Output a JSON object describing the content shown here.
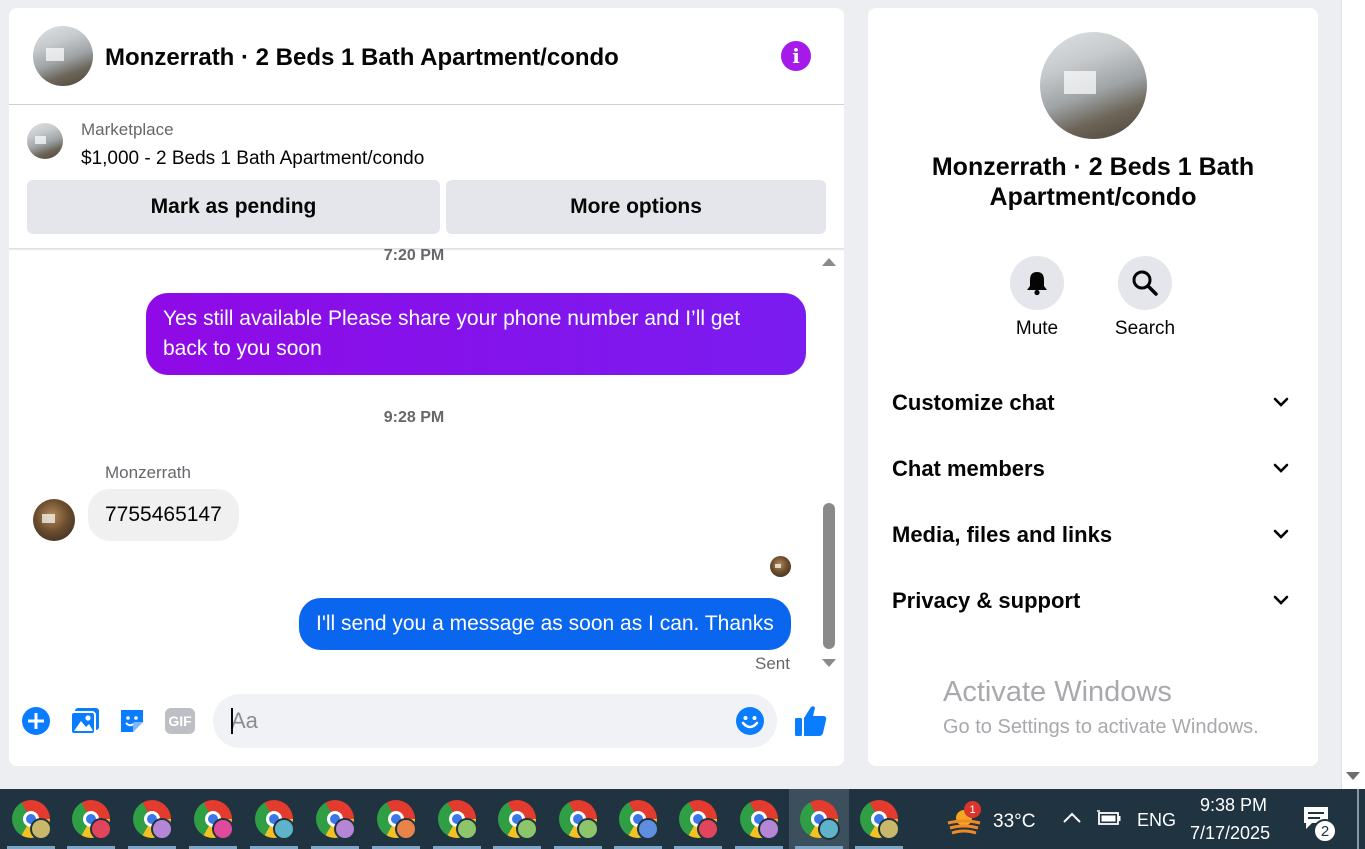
{
  "chat": {
    "title": "Monzerrath · 2 Beds 1 Bath Apartment/condo",
    "info_icon": "info-icon",
    "marketplace_label": "Marketplace",
    "listing": "$1,000 - 2 Beds 1 Bath Apartment/condo",
    "mark_pending_label": "Mark as pending",
    "more_options_label": "More options",
    "messages": [
      {
        "type": "timestamp",
        "text": "7:20 PM"
      },
      {
        "type": "outgoing",
        "text": "Yes still available Please share your phone number and I’ll get back to you soon"
      },
      {
        "type": "timestamp",
        "text": "9:28 PM"
      },
      {
        "type": "sender_name",
        "text": "Monzerrath"
      },
      {
        "type": "incoming",
        "text": "7755465147"
      },
      {
        "type": "outgoing",
        "text": "I'll send you a message as soon as I can. Thanks"
      },
      {
        "type": "status",
        "text": "Sent"
      }
    ],
    "composer": {
      "placeholder": "Aa",
      "icons": [
        "plus-icon",
        "photo-icon",
        "sticker-icon",
        "gif-icon",
        "emoji-icon",
        "like-icon"
      ],
      "gif_label": "GIF"
    },
    "colors": {
      "outgoing_purple": "#8a0be0",
      "outgoing_blue": "#0a66ee",
      "incoming": "#f0f0f0",
      "accent": "#0a7cff"
    }
  },
  "info": {
    "title": "Monzerrath · 2 Beds 1 Bath Apartment/condo",
    "mute_label": "Mute",
    "search_label": "Search",
    "sections": [
      "Customize chat",
      "Chat members",
      "Media, files and links",
      "Privacy & support"
    ]
  },
  "watermark": {
    "line1": "Activate Windows",
    "line2": "Go to Settings to activate Windows."
  },
  "taskbar": {
    "weather_badge": "1",
    "temperature": "33°C",
    "language": "ENG",
    "time": "9:38 PM",
    "date": "7/17/2025",
    "notifications": "2",
    "profile_colors": [
      "#c8b96a",
      "#e0455c",
      "#b586d6",
      "#e04a9c",
      "#5fb3c8",
      "#b586d6",
      "#e8844a",
      "#8cc56a",
      "#8cc56a",
      "#8cc56a",
      "#5f8ee0",
      "#e0455c",
      "#b586d6",
      "#5fb3c8",
      "#c8b96a"
    ]
  }
}
